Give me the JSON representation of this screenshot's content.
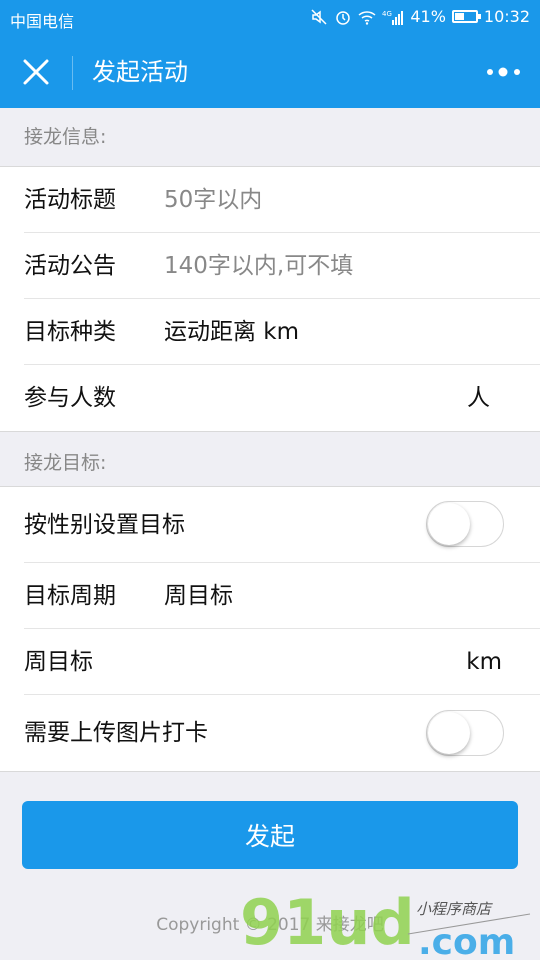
{
  "status_bar": {
    "carrier": "中国电信",
    "battery": "41%",
    "battery_level": 0.41,
    "time": "10:32",
    "network": "4G"
  },
  "nav": {
    "title": "发起活动",
    "close_icon": "close-icon",
    "more_icon": "more-icon"
  },
  "sections": {
    "info_label": "接龙信息:",
    "target_label": "接龙目标:"
  },
  "info_rows": {
    "title_label": "活动标题",
    "title_placeholder": "50字以内",
    "notice_label": "活动公告",
    "notice_placeholder": "140字以内,可不填",
    "type_label": "目标种类",
    "type_value": "运动距离 km",
    "people_label": "参与人数",
    "people_unit": "人"
  },
  "target_rows": {
    "gender_label": "按性别设置目标",
    "gender_toggle_on": false,
    "period_label": "目标周期",
    "period_value": "周目标",
    "weekly_label": "周目标",
    "weekly_unit": "km",
    "upload_label": "需要上传图片打卡",
    "upload_toggle_on": false
  },
  "submit_label": "发起",
  "copyright": "Copyright © 2017 来接龙吧",
  "watermark": {
    "main": "91ud",
    "suffix": ".com",
    "tagline": "小程序商店"
  },
  "colors": {
    "primary": "#1a98ea",
    "background": "#efeff4",
    "watermark_green": "#8fd14f",
    "watermark_blue": "#4aaee8"
  }
}
